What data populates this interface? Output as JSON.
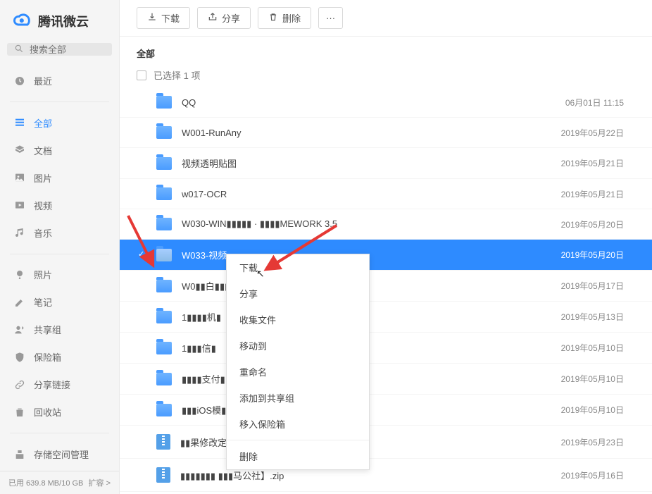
{
  "brand": {
    "name": "腾讯微云"
  },
  "search": {
    "placeholder": "搜索全部"
  },
  "nav": {
    "recent": "最近",
    "all": "全部",
    "docs": "文档",
    "images": "图片",
    "videos": "视频",
    "music": "音乐",
    "photos": "照片",
    "notes": "笔记",
    "sharegroup": "共享组",
    "safebox": "保险箱",
    "sharelink": "分享链接",
    "trash": "回收站",
    "storage": "存储空间管理"
  },
  "footer": {
    "usage": "已用 639.8 MB/10 GB",
    "expand": "扩容 >"
  },
  "toolbar": {
    "download": "下载",
    "share": "分享",
    "delete": "删除",
    "more": "···"
  },
  "heading": "全部",
  "selection": "已选择 1 项",
  "files": [
    {
      "name": "QQ",
      "date": "06月01日 11:15",
      "type": "folder"
    },
    {
      "name": "W001-RunAny",
      "date": "2019年05月22日",
      "type": "folder"
    },
    {
      "name": "视频透明贴图",
      "date": "2019年05月21日",
      "type": "folder"
    },
    {
      "name": "w017-OCR",
      "date": "2019年05月21日",
      "type": "folder"
    },
    {
      "name": "W030-WIN▮▮▮▮▮ · ▮▮▮▮MEWORK 3.5",
      "date": "2019年05月20日",
      "type": "folder"
    },
    {
      "name": "W033-视频",
      "date": "2019年05月20日",
      "type": "folder",
      "selected": true
    },
    {
      "name": "W0▮▮白▮▮▮",
      "date": "2019年05月17日",
      "type": "folder"
    },
    {
      "name": "1▮▮▮▮机▮",
      "date": "2019年05月13日",
      "type": "folder"
    },
    {
      "name": "1▮▮▮信▮",
      "date": "2019年05月10日",
      "type": "folder"
    },
    {
      "name": "▮▮▮▮支付▮",
      "date": "2019年05月10日",
      "type": "folder"
    },
    {
      "name": "▮▮▮iOS模▮",
      "date": "2019年05月10日",
      "type": "folder"
    },
    {
      "name": "▮▮果修改定位(1).zip",
      "date": "2019年05月23日",
      "type": "zip"
    },
    {
      "name": "▮▮▮▮▮▮▮ ▮▮▮马公社】.zip",
      "date": "2019年05月16日",
      "type": "zip"
    }
  ],
  "context_menu": {
    "download": "下载",
    "share": "分享",
    "collect": "收集文件",
    "moveto": "移动到",
    "rename": "重命名",
    "addshare": "添加到共享组",
    "tosafebox": "移入保险箱",
    "delete": "删除"
  }
}
